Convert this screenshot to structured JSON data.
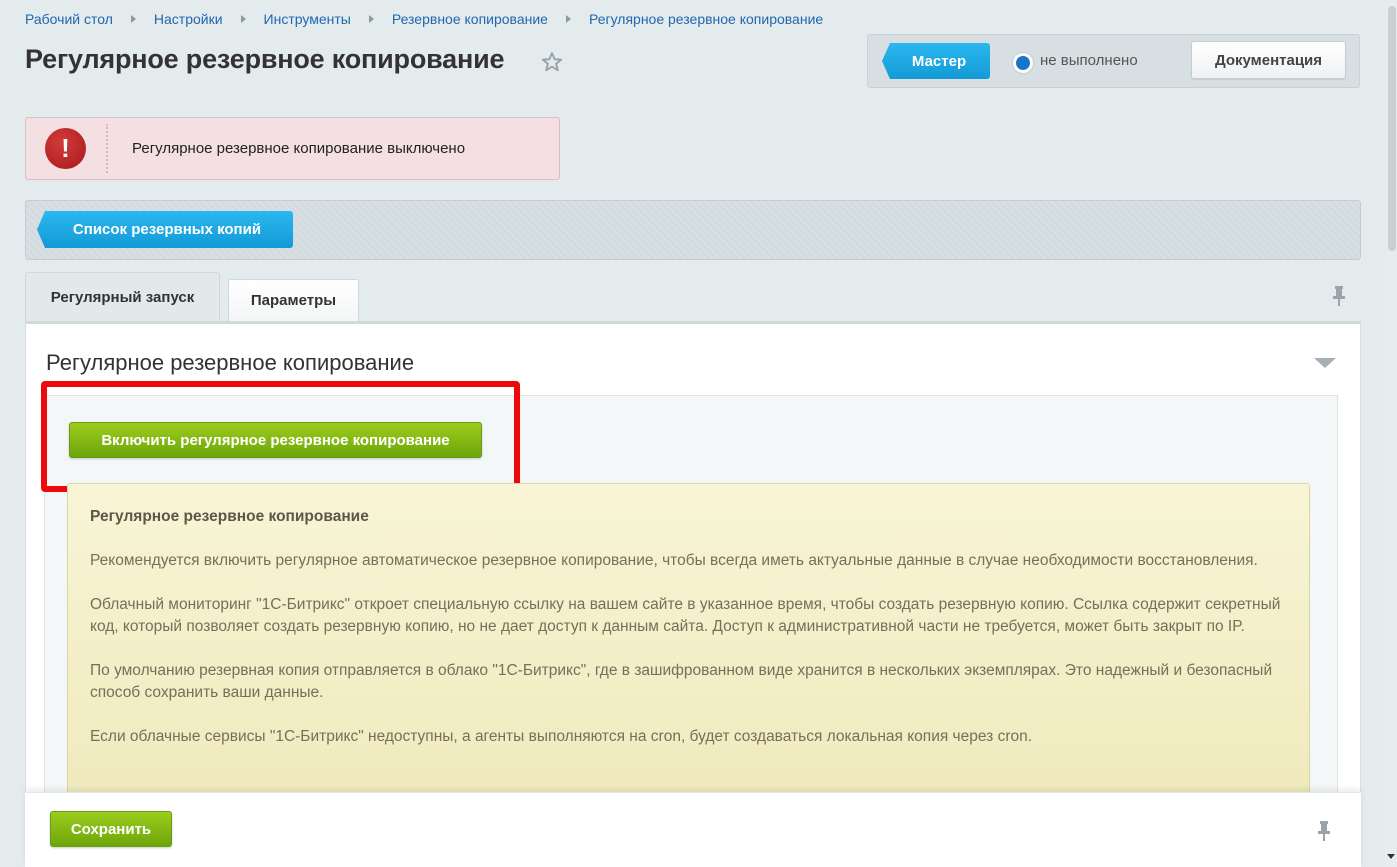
{
  "breadcrumb": [
    "Рабочий стол",
    "Настройки",
    "Инструменты",
    "Резервное копирование",
    "Регулярное резервное копирование"
  ],
  "page_title": "Регулярное резервное копирование",
  "top_panel": {
    "master_label": "Мастер",
    "status_label": "не выполнено",
    "docs_label": "Документация"
  },
  "alert": {
    "text": "Регулярное резервное копирование выключено"
  },
  "toolbar": {
    "list_label": "Список резервных копий"
  },
  "tabs": [
    {
      "label": "Регулярный запуск",
      "active": true
    },
    {
      "label": "Параметры",
      "active": false
    }
  ],
  "section": {
    "title": "Регулярное резервное копирование",
    "enable_label": "Включить регулярное резервное копирование"
  },
  "info": {
    "heading": "Регулярное резервное копирование",
    "paragraphs": [
      "Рекомендуется включить регулярное автоматическое резервное копирование, чтобы всегда иметь актуальные данные в случае необходимости восстановления.",
      "Облачный мониторинг \"1С-Битрикс\" откроет специальную ссылку на вашем сайте в указанное время, чтобы создать резервную копию. Ссылка содержит секретный код, который позволяет создать резервную копию, но не дает доступ к данным сайта. Доступ к административной части не требуется, может быть закрыт по IP.",
      "По умолчанию резервная копия отправляется в облако \"1С-Битрикс\", где в зашифрованном виде хранится в нескольких экземплярах. Это надежный и безопасный способ сохранить ваши данные.",
      "Если облачные сервисы \"1С-Битрикс\" недоступны, а агенты выполняются на cron, будет создаваться локальная копия через cron."
    ]
  },
  "footer": {
    "save_label": "Сохранить"
  },
  "colors": {
    "accent_blue": "#1ea9e6",
    "accent_green": "#7fb514",
    "alert_red": "#c22b2b",
    "highlight_red": "#ee0a0a"
  },
  "icons": [
    "star-icon",
    "alert-exclamation-icon",
    "pin-icon",
    "collapse-chevron-icon",
    "status-radio-icon"
  ]
}
